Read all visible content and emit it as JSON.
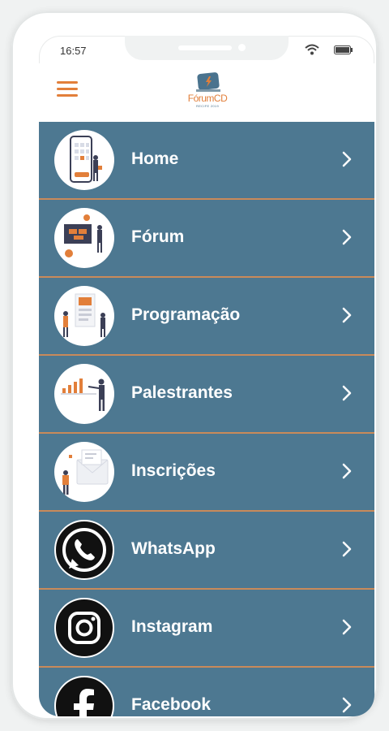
{
  "status_bar": {
    "time": "16:57"
  },
  "header": {
    "logo_text": "FórumCD",
    "logo_subtext": "RECIFE 2019"
  },
  "colors": {
    "accent": "#e27f3a",
    "menu_background": "#4d7891",
    "divider": "#c98a5a",
    "label": "#ffffff"
  },
  "menu": {
    "items": [
      {
        "label": "Home",
        "icon": "phone-illustration-icon"
      },
      {
        "label": "Fórum",
        "icon": "presentation-illustration-icon"
      },
      {
        "label": "Programação",
        "icon": "schedule-illustration-icon"
      },
      {
        "label": "Palestrantes",
        "icon": "speaker-illustration-icon"
      },
      {
        "label": "Inscrições",
        "icon": "registration-illustration-icon"
      },
      {
        "label": "WhatsApp",
        "icon": "whatsapp-icon"
      },
      {
        "label": "Instagram",
        "icon": "instagram-icon"
      },
      {
        "label": "Facebook",
        "icon": "facebook-icon"
      }
    ]
  }
}
